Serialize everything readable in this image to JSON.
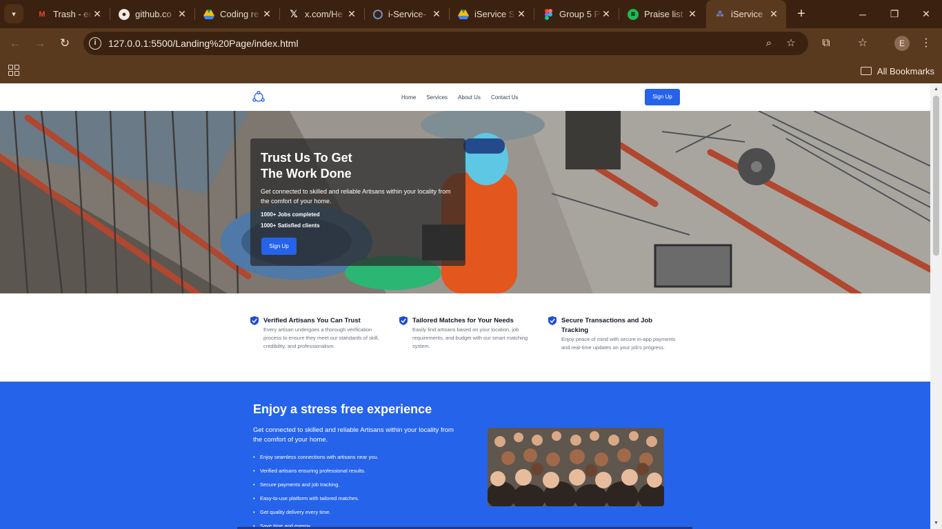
{
  "browser": {
    "tabs": [
      {
        "title": "Trash - ee",
        "icon": "gmail-icon"
      },
      {
        "title": "github.co",
        "icon": "github-icon"
      },
      {
        "title": "Coding re",
        "icon": "drive-icon"
      },
      {
        "title": "x.com/He",
        "icon": "x-icon"
      },
      {
        "title": "i-Service-",
        "icon": "github-loading-icon"
      },
      {
        "title": "iService S",
        "icon": "drive-icon"
      },
      {
        "title": "Group 5 P",
        "icon": "figma-icon"
      },
      {
        "title": "Praise list",
        "icon": "spotify-icon"
      },
      {
        "title": "iService",
        "icon": "iservice-icon",
        "active": true
      }
    ],
    "url": "127.0.0.1:5500/Landing%20Page/index.html",
    "profile_initial": "E",
    "bookmarks_label": "All Bookmarks"
  },
  "site": {
    "nav": {
      "links": [
        "Home",
        "Services",
        "About Us",
        "Contact Us"
      ],
      "signup_label": "Sign Up"
    },
    "hero": {
      "title_line1": "Trust Us To Get",
      "title_line2": "The Work Done",
      "subtitle": "Get connected to skilled and reliable Artisans within your locality from the comfort of your home.",
      "stat1": "1000+ Jobs completed",
      "stat2": "1000+ Satisfied clients",
      "signup_label": "Sign Up"
    },
    "features": [
      {
        "title": "Verified Artisans You Can Trust",
        "desc": "Every artisan undergoes a thorough verification process to ensure they meet our standards of skill, credibility, and professionalism."
      },
      {
        "title": "Tailored Matches for Your Needs",
        "desc": "Easily find artisans based on your location, job requirements, and budget with our smart matching system."
      },
      {
        "title": "Secure Transactions and Job Tracking",
        "desc": "Enjoy peace of mind with secure in-app payments and real-time updates on your job's progress."
      }
    ],
    "stress_free": {
      "title": "Enjoy a stress free experience",
      "subtitle": "Get connected to skilled and reliable Artisans within your locality from the comfort of your home.",
      "bullets": [
        "Enjoy seamless connections with artisans near you.",
        "Verified artisans ensuring professional results.",
        "Secure payments and job tracking.",
        "Easy-to-use platform with tailored matches.",
        "Get quality delivery every time.",
        "Save time and energy"
      ]
    }
  },
  "colors": {
    "chrome_dark": "#3b2210",
    "chrome_mid": "#5a3a1f",
    "brand_blue": "#2563eb"
  }
}
